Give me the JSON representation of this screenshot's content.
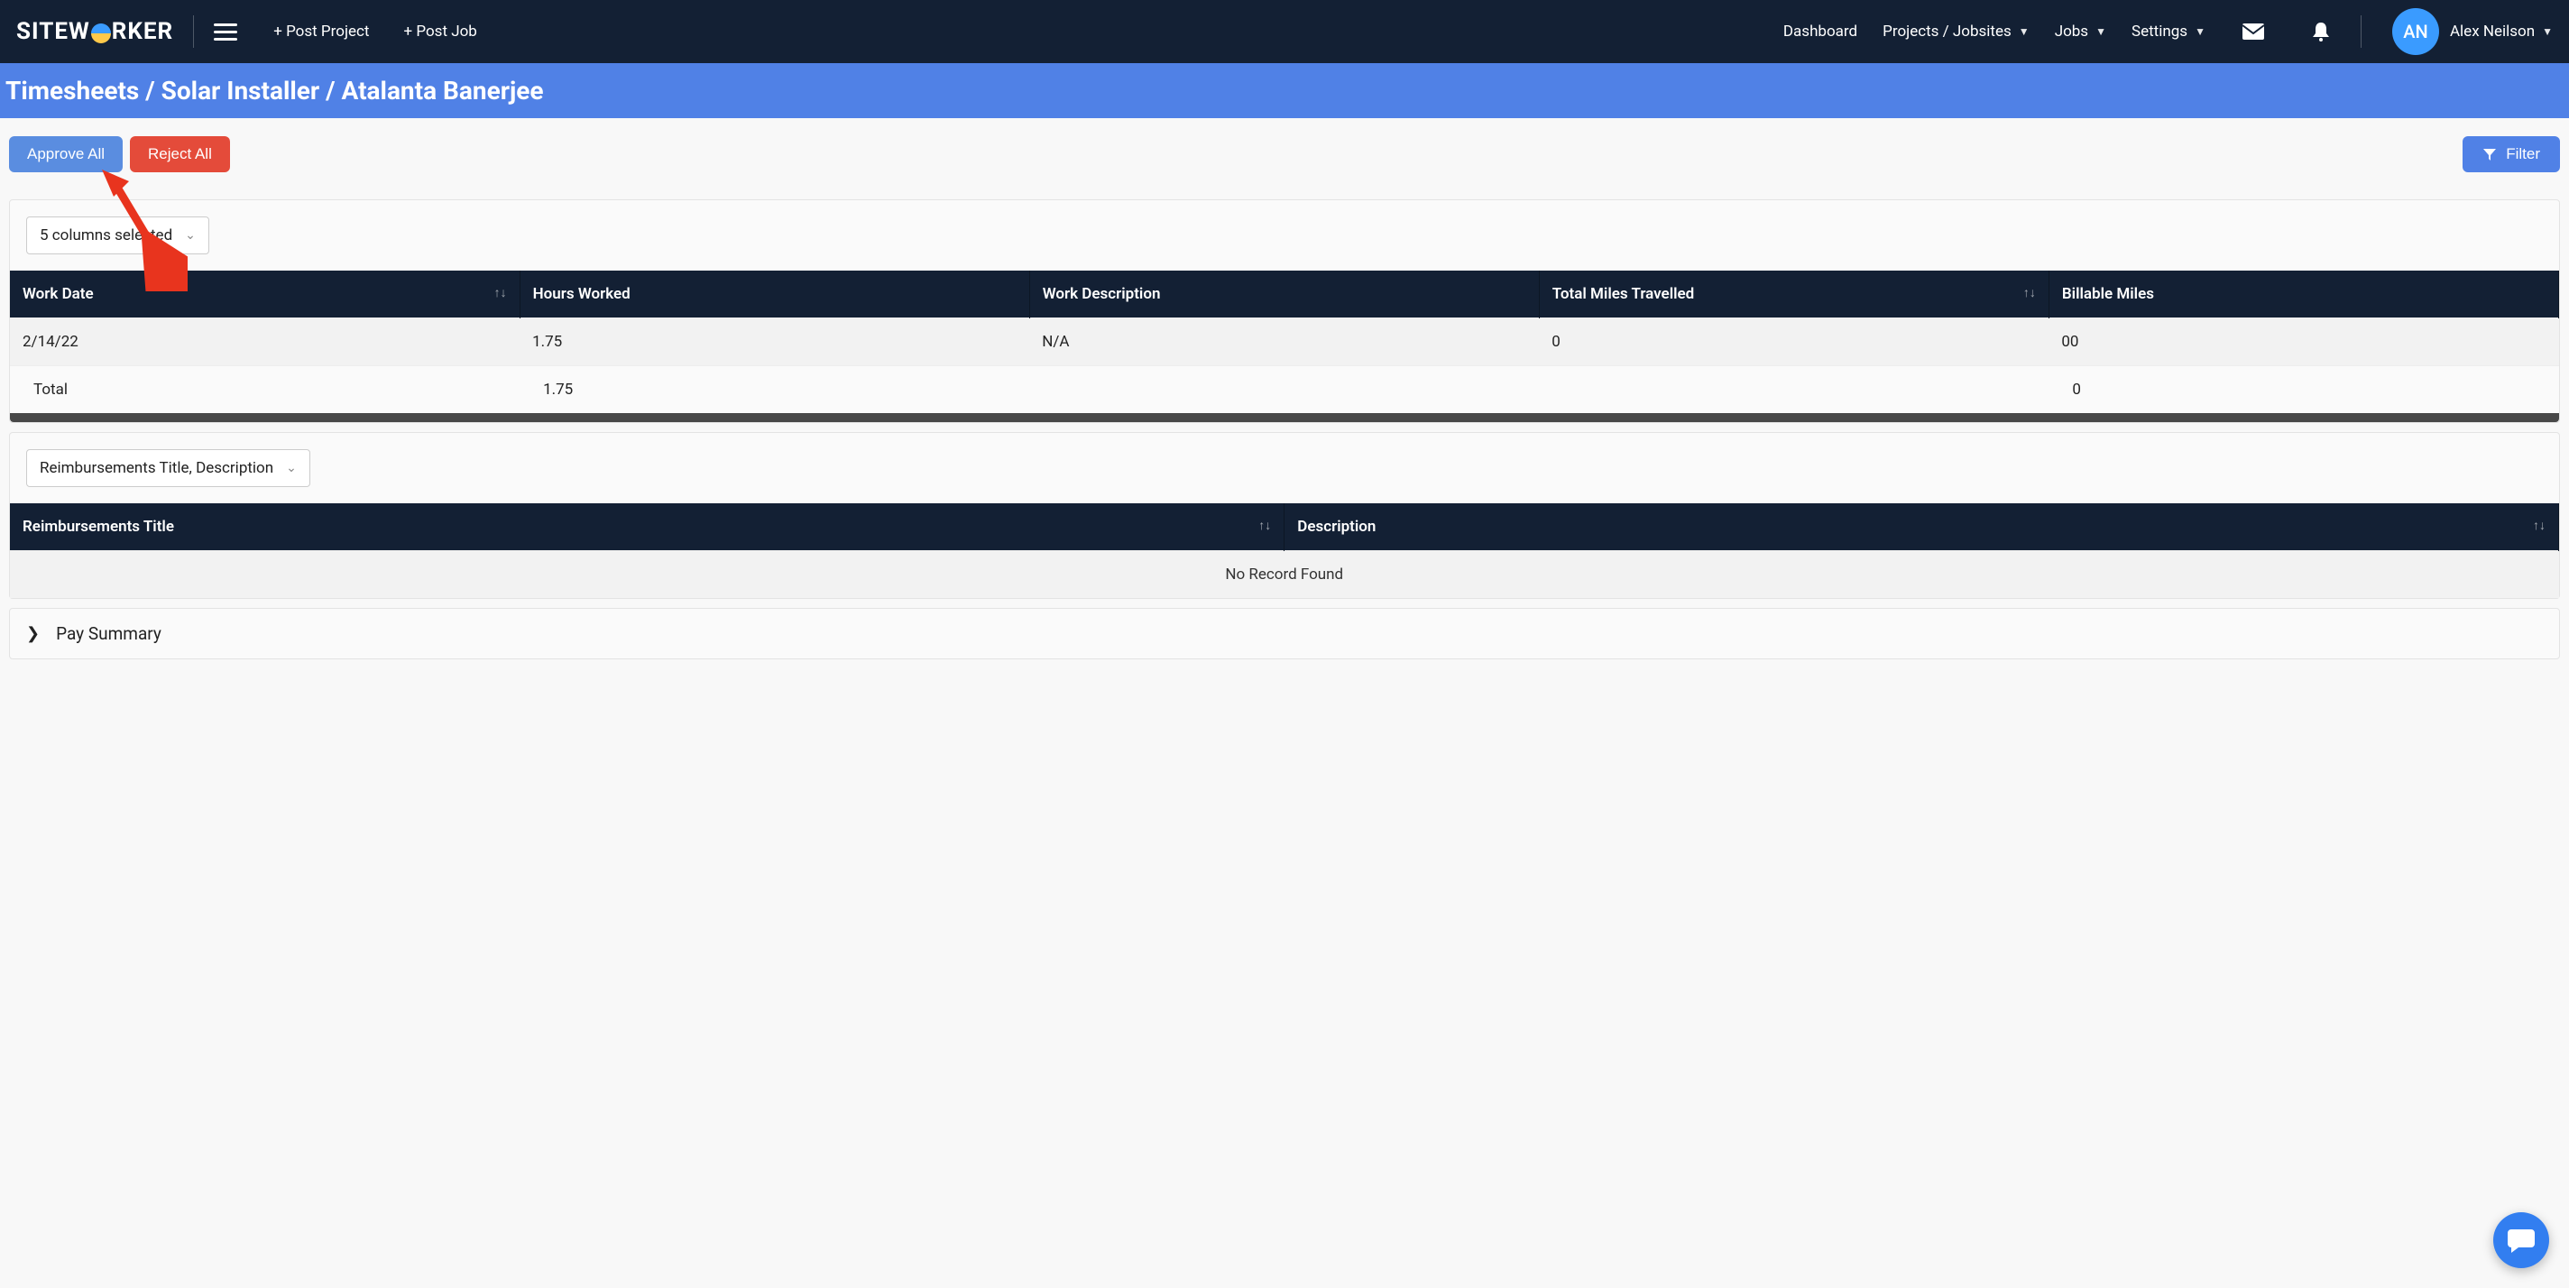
{
  "brand": {
    "prefix": "SITEW",
    "suffix": "RKER"
  },
  "nav": {
    "post_project": "+ Post Project",
    "post_job": "+ Post Job",
    "dashboard": "Dashboard",
    "projects": "Projects / Jobsites",
    "jobs": "Jobs",
    "settings": "Settings"
  },
  "user": {
    "initials": "AN",
    "name": "Alex Neilson"
  },
  "breadcrumb": "Timesheets / Solar Installer / Atalanta Banerjee",
  "actions": {
    "approve_all": "Approve All",
    "reject_all": "Reject All",
    "filter": "Filter"
  },
  "timesheet": {
    "columns_selector": "5 columns selected",
    "headers": {
      "work_date": "Work Date",
      "hours_worked": "Hours Worked",
      "work_description": "Work Description",
      "total_miles": "Total Miles Travelled",
      "billable_miles": "Billable Miles"
    },
    "rows": [
      {
        "date": "2/14/22",
        "hours": "1.75",
        "desc": "N/A",
        "miles": "0",
        "billable": "00"
      }
    ],
    "total_label": "Total",
    "total_hours": "1.75",
    "total_billable": "0"
  },
  "reimbursements": {
    "selector": "Reimbursements Title, Description",
    "headers": {
      "title": "Reimbursements Title",
      "description": "Description"
    },
    "empty": "No Record Found"
  },
  "pay_summary": "Pay Summary"
}
